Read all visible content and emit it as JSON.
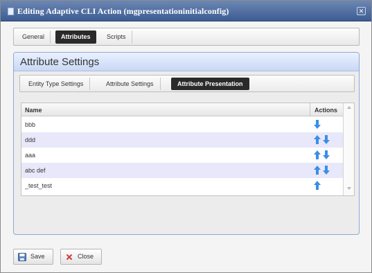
{
  "window": {
    "title": "Editing Adaptive CLI Action (mgpresentationinitialconfig)",
    "close_symbol": "✕"
  },
  "top_tabs": [
    {
      "label": "General",
      "active": false
    },
    {
      "label": "Attributes",
      "active": true
    },
    {
      "label": "Scripts",
      "active": false
    }
  ],
  "panel": {
    "title": "Attribute Settings",
    "sub_tabs": [
      {
        "label": "Entity Type Settings",
        "active": false
      },
      {
        "label": "Attribute Settings",
        "active": false
      },
      {
        "label": "Attribute Presentation",
        "active": true
      }
    ]
  },
  "grid": {
    "columns": {
      "name": "Name",
      "actions": "Actions"
    },
    "rows": [
      {
        "name": "bbb",
        "actions": [
          "move-down-icon"
        ]
      },
      {
        "name": "ddd",
        "actions": [
          "move-up-icon",
          "move-down-icon"
        ]
      },
      {
        "name": "aaa",
        "actions": [
          "move-up-icon",
          "move-down-icon"
        ]
      },
      {
        "name": "abc def",
        "actions": [
          "move-up-icon",
          "move-down-icon"
        ]
      },
      {
        "name": "_test_test",
        "actions": [
          "move-up-icon"
        ]
      }
    ]
  },
  "footer": {
    "save_label": "Save",
    "close_label": "Close"
  },
  "colors": {
    "arrow_blue": "#3a8ee6",
    "active_tab": "#2a2a2a",
    "title_bar": "#3c5c93",
    "alt_row": "#e8e8fa",
    "close_x_red": "#d43b3b"
  }
}
